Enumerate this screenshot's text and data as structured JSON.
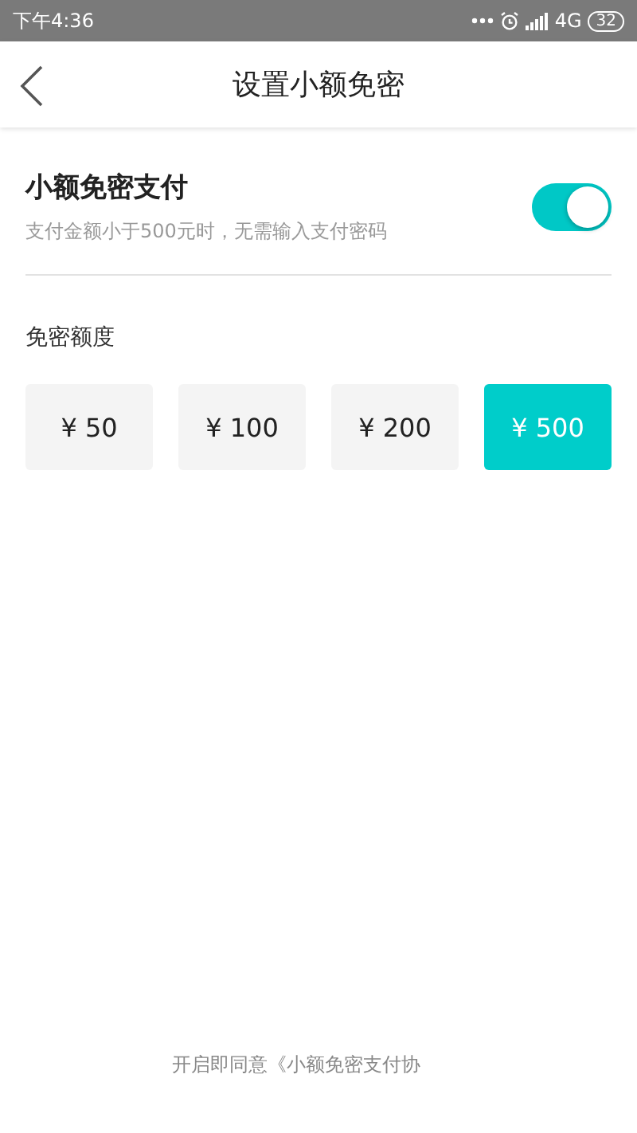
{
  "status_bar": {
    "time": "下午4:36",
    "network": "4G",
    "battery": "32"
  },
  "nav": {
    "title": "设置小额免密"
  },
  "setting": {
    "title": "小额免密支付",
    "description": "支付金额小于500元时，无需输入支付密码",
    "on": true
  },
  "limit": {
    "label": "免密额度",
    "options": [
      {
        "label": "¥ 50",
        "selected": false
      },
      {
        "label": "¥ 100",
        "selected": false
      },
      {
        "label": "¥ 200",
        "selected": false
      },
      {
        "label": "¥ 500",
        "selected": true
      }
    ]
  },
  "footer": {
    "agreement": "开启即同意《小额免密支付协"
  }
}
